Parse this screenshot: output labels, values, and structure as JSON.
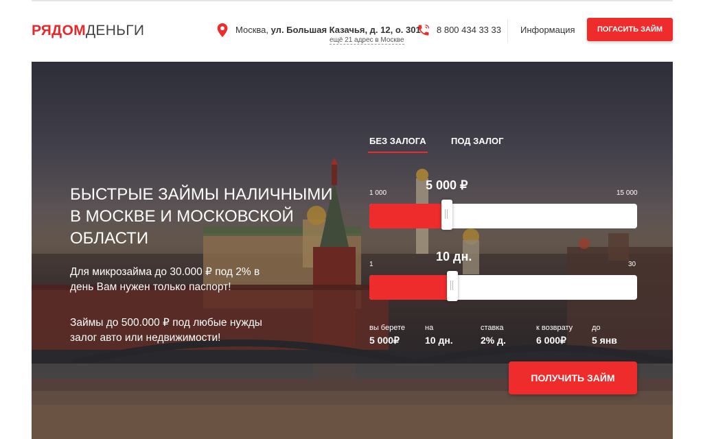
{
  "header": {
    "logo_red": "РЯДОМ",
    "logo_dark": "ДЕНЬГИ",
    "address_city": "Москва,",
    "address_street": "ул. Большая Казачья, д. 12, о. 301",
    "address_more": "ещё 21 адрес в Москве",
    "phone": "8 800 434 33 33",
    "info_link": "Информация",
    "repay_button": "ПОГАСИТЬ ЗАЙМ"
  },
  "hero": {
    "title": "БЫСТРЫЕ ЗАЙМЫ НАЛИЧНЫМИ В МОСКВЕ И МОСКОВСКОЙ ОБЛАСТИ",
    "paragraph1": "Для микрозайма до 30.000 ₽ под 2% в день Вам нужен только паспорт!",
    "paragraph2": "Займы до 500.000 ₽ под любые нужды залог авто или недвижимости!"
  },
  "calculator": {
    "tabs": [
      {
        "label": "БЕЗ ЗАЛОГА",
        "active": true
      },
      {
        "label": "ПОД ЗАЛОГ",
        "active": false
      }
    ],
    "amount": {
      "min": "1 000",
      "max": "15 000",
      "value": "5 000 ₽",
      "fraction": 0.29
    },
    "days": {
      "min": "1",
      "max": "30",
      "value": "10 дн.",
      "fraction": 0.31
    },
    "summary": [
      {
        "label": "вы берете",
        "value": "5 000₽"
      },
      {
        "label": "на",
        "value": "10 дн."
      },
      {
        "label": "ставка",
        "value": "2% д."
      },
      {
        "label": "к возврату",
        "value": "6 000₽"
      },
      {
        "label": "до",
        "value": "5 янв"
      }
    ],
    "submit_button": "ПОЛУЧИТЬ ЗАЙМ"
  },
  "colors": {
    "accent": "#ef2c2c",
    "text_dark": "#333333"
  }
}
